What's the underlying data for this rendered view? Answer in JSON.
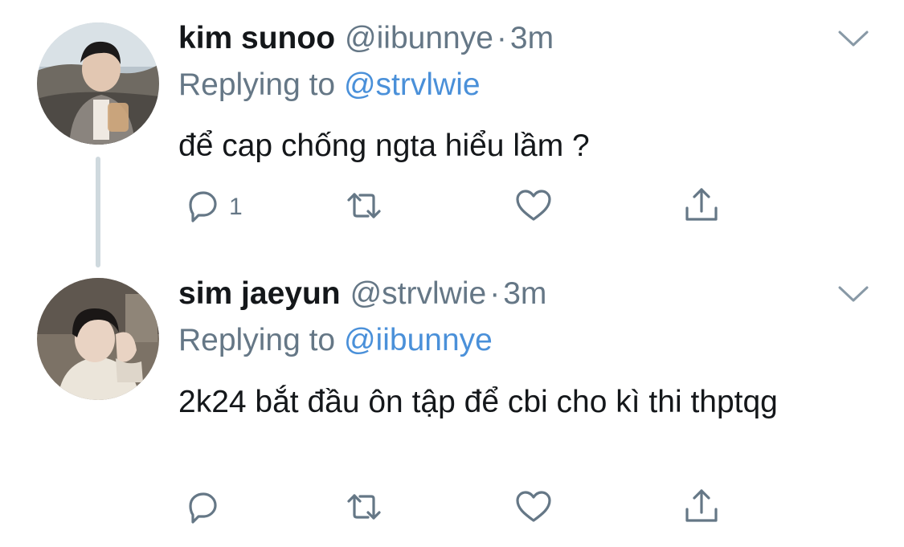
{
  "tweets": [
    {
      "name": "kim sunoo",
      "handle": "@iibunnye",
      "separator": "·",
      "time": "3m",
      "replying_prefix": "Replying to",
      "replying_to": "@strvlwie",
      "text": "để cap chống ngta hiểu lầm ?",
      "reply_count": "1"
    },
    {
      "name": "sim jaeyun",
      "handle": "@strvlwie",
      "separator": "·",
      "time": "3m",
      "replying_prefix": "Replying to",
      "replying_to": "@iibunnye",
      "text": "2k24 bắt đầu ôn tập để cbi cho kì thi thptqg",
      "reply_count": ""
    }
  ],
  "colors": {
    "text": "#14171a",
    "secondary": "#657786",
    "link": "#4a90d9",
    "thread_line": "#cfd9de"
  },
  "icons": [
    "reply-icon",
    "retweet-icon",
    "like-icon",
    "share-icon",
    "chevron-down-icon"
  ]
}
